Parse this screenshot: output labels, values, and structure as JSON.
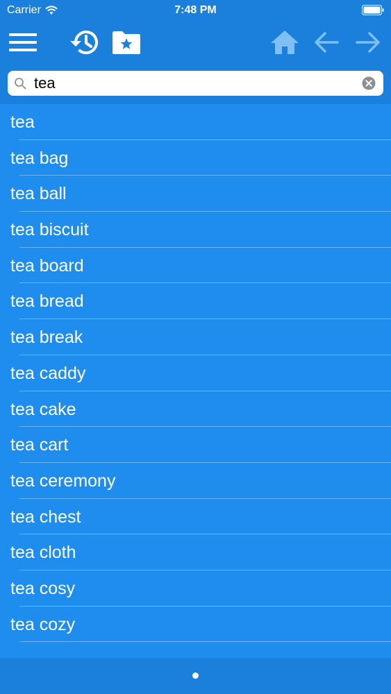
{
  "status_bar": {
    "carrier": "Carrier",
    "time": "7:48 PM"
  },
  "toolbar": {
    "menu_icon": "hamburger-menu-icon",
    "history_icon": "history-clock-icon",
    "favorites_icon": "folder-star-icon",
    "home_icon": "home-icon",
    "back_icon": "arrow-left-icon",
    "forward_icon": "arrow-right-icon"
  },
  "search": {
    "value": "tea",
    "icon": "search-icon",
    "clear_icon": "clear-icon"
  },
  "results": [
    {
      "label": "tea"
    },
    {
      "label": "tea bag"
    },
    {
      "label": "tea ball"
    },
    {
      "label": "tea biscuit"
    },
    {
      "label": "tea board"
    },
    {
      "label": "tea bread"
    },
    {
      "label": "tea break"
    },
    {
      "label": "tea caddy"
    },
    {
      "label": "tea cake"
    },
    {
      "label": "tea cart"
    },
    {
      "label": "tea ceremony"
    },
    {
      "label": "tea chest"
    },
    {
      "label": "tea cloth"
    },
    {
      "label": "tea cosy"
    },
    {
      "label": "tea cozy"
    }
  ],
  "colors": {
    "bar": "#1b7fdc",
    "list": "#1f8ded",
    "icon_dim": "#7fbff5"
  }
}
